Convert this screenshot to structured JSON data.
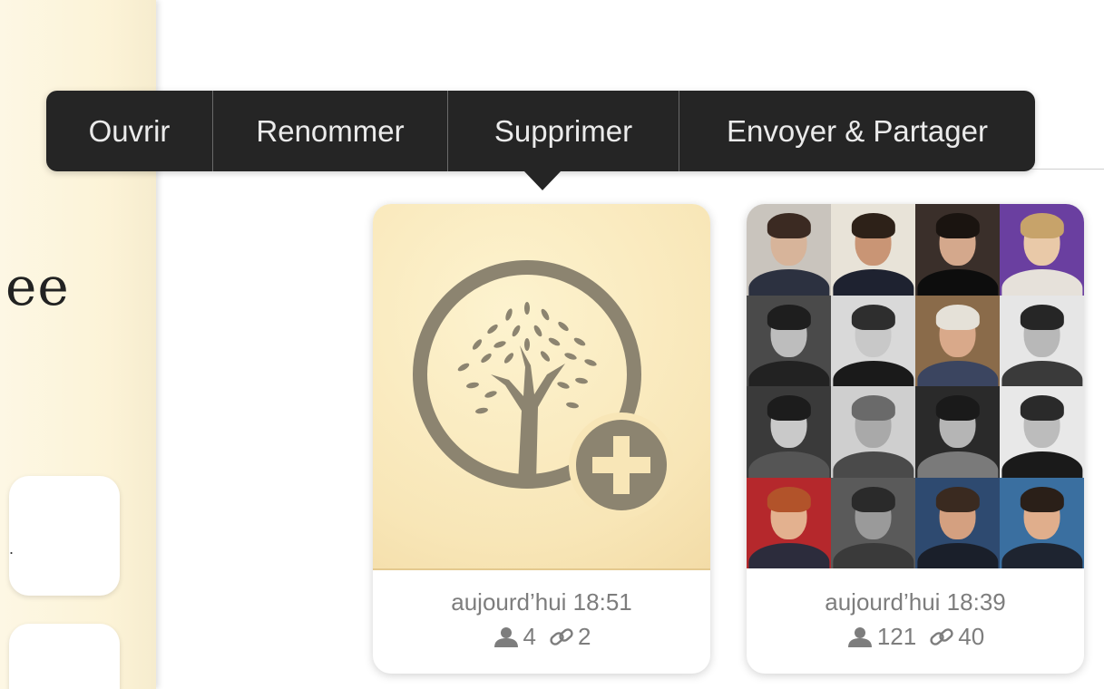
{
  "sidebar": {
    "title_fragment": "ee",
    "card_mark": "."
  },
  "context_menu": {
    "items": [
      {
        "label": "Ouvrir"
      },
      {
        "label": "Renommer"
      },
      {
        "label": "Supprimer"
      },
      {
        "label": "Envoyer & Partager"
      }
    ]
  },
  "trees": [
    {
      "icon": "tree-plus-icon",
      "date": "aujourd’hui 18:51",
      "persons": "4",
      "relations": "2"
    },
    {
      "icon": "portrait-mosaic",
      "date": "aujourd’hui 18:39",
      "persons": "121",
      "relations": "40"
    }
  ],
  "colors": {
    "menu_bg": "#252525",
    "sidebar_bg": "#fcf3d7",
    "tree_icon": "#8c8470",
    "meta_text": "#7d7d7d"
  }
}
